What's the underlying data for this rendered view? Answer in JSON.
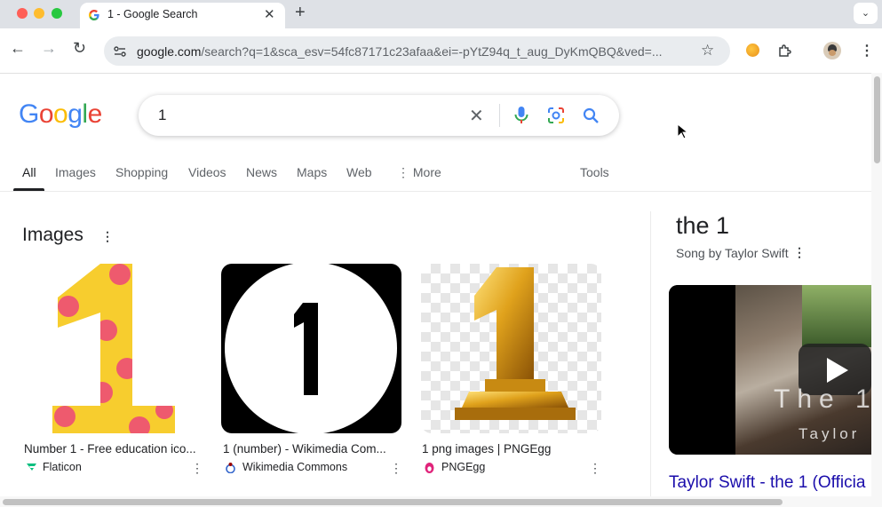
{
  "browser": {
    "tab_title": "1 - Google Search",
    "new_tab": "+",
    "url_domain": "google.com",
    "url_rest": "/search?q=1&sca_esv=54fc87171c23afaa&ei=-pYtZ94q_t_aug_DyKmQBQ&ved=..."
  },
  "logo": {
    "letters": [
      "G",
      "o",
      "o",
      "g",
      "l",
      "e"
    ],
    "colors": [
      "#4285F4",
      "#EA4335",
      "#FBBC05",
      "#4285F4",
      "#34A853",
      "#EA4335"
    ]
  },
  "search": {
    "query": "1"
  },
  "nav": {
    "tabs": [
      "All",
      "Images",
      "Shopping",
      "Videos",
      "News",
      "Maps",
      "Web",
      "More"
    ],
    "active": "All",
    "tools": "Tools"
  },
  "images_section": {
    "title": "Images",
    "cards": [
      {
        "caption": "Number 1 - Free education ico...",
        "source": "Flaticon"
      },
      {
        "caption": "1 (number) - Wikimedia Com...",
        "source": "Wikimedia Commons"
      },
      {
        "caption": "1 png images | PNGEgg",
        "source": "PNGEgg"
      }
    ]
  },
  "knowledge_panel": {
    "title": "the 1",
    "subtitle": "Song by Taylor Swift",
    "video_overlay_text": "The 1",
    "video_overlay_sub": "Taylor",
    "video_link": "Taylor Swift - the 1 (Officia"
  },
  "colors": {
    "link": "#1a0dab",
    "accent_blue": "#4285F4"
  }
}
